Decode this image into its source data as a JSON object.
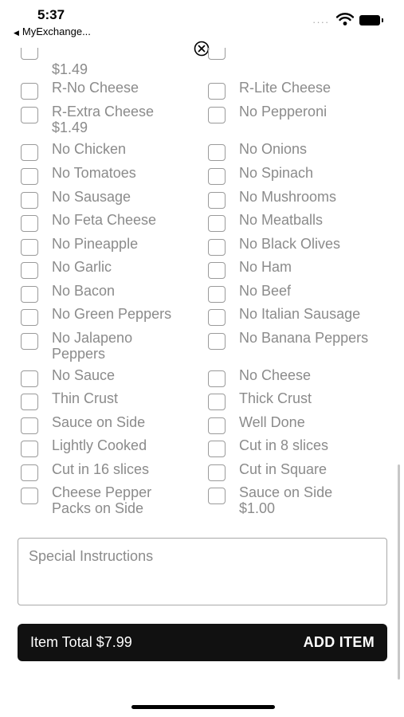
{
  "status": {
    "time": "5:37",
    "back_app": "MyExchange...",
    "signal_dots": "····"
  },
  "partial_top": {
    "price": "$1.49"
  },
  "options": [
    {
      "label": "R-No Cheese",
      "label2": ""
    },
    {
      "label": "R-Lite Cheese",
      "label2": ""
    },
    {
      "label": "R-Extra Cheese",
      "label2": "$1.49"
    },
    {
      "label": "No Pepperoni",
      "label2": ""
    },
    {
      "label": "No Chicken",
      "label2": ""
    },
    {
      "label": "No Onions",
      "label2": ""
    },
    {
      "label": "No Tomatoes",
      "label2": ""
    },
    {
      "label": "No Spinach",
      "label2": ""
    },
    {
      "label": "No Sausage",
      "label2": ""
    },
    {
      "label": "No Mushrooms",
      "label2": ""
    },
    {
      "label": "No Feta Cheese",
      "label2": ""
    },
    {
      "label": "No Meatballs",
      "label2": ""
    },
    {
      "label": "No Pineapple",
      "label2": ""
    },
    {
      "label": "No Black Olives",
      "label2": ""
    },
    {
      "label": "No Garlic",
      "label2": ""
    },
    {
      "label": "No Ham",
      "label2": ""
    },
    {
      "label": "No Bacon",
      "label2": ""
    },
    {
      "label": "No Beef",
      "label2": ""
    },
    {
      "label": "No Green Peppers",
      "label2": ""
    },
    {
      "label": "No Italian Sausage",
      "label2": ""
    },
    {
      "label": "No Jalapeno",
      "label2": "Peppers"
    },
    {
      "label": "No Banana Peppers",
      "label2": ""
    },
    {
      "label": "No Sauce",
      "label2": ""
    },
    {
      "label": "No Cheese",
      "label2": ""
    },
    {
      "label": "Thin Crust",
      "label2": ""
    },
    {
      "label": "Thick Crust",
      "label2": ""
    },
    {
      "label": "Sauce on Side",
      "label2": ""
    },
    {
      "label": "Well Done",
      "label2": ""
    },
    {
      "label": "Lightly Cooked",
      "label2": ""
    },
    {
      "label": "Cut in 8 slices",
      "label2": ""
    },
    {
      "label": "Cut in 16 slices",
      "label2": ""
    },
    {
      "label": "Cut in Square",
      "label2": ""
    },
    {
      "label": "Cheese Pepper",
      "label2": "Packs on Side"
    },
    {
      "label": "Sauce on Side",
      "label2": "$1.00"
    }
  ],
  "special_instructions": {
    "placeholder": "Special Instructions"
  },
  "footer": {
    "item_total": "Item Total $7.99",
    "add_item": "ADD ITEM"
  }
}
